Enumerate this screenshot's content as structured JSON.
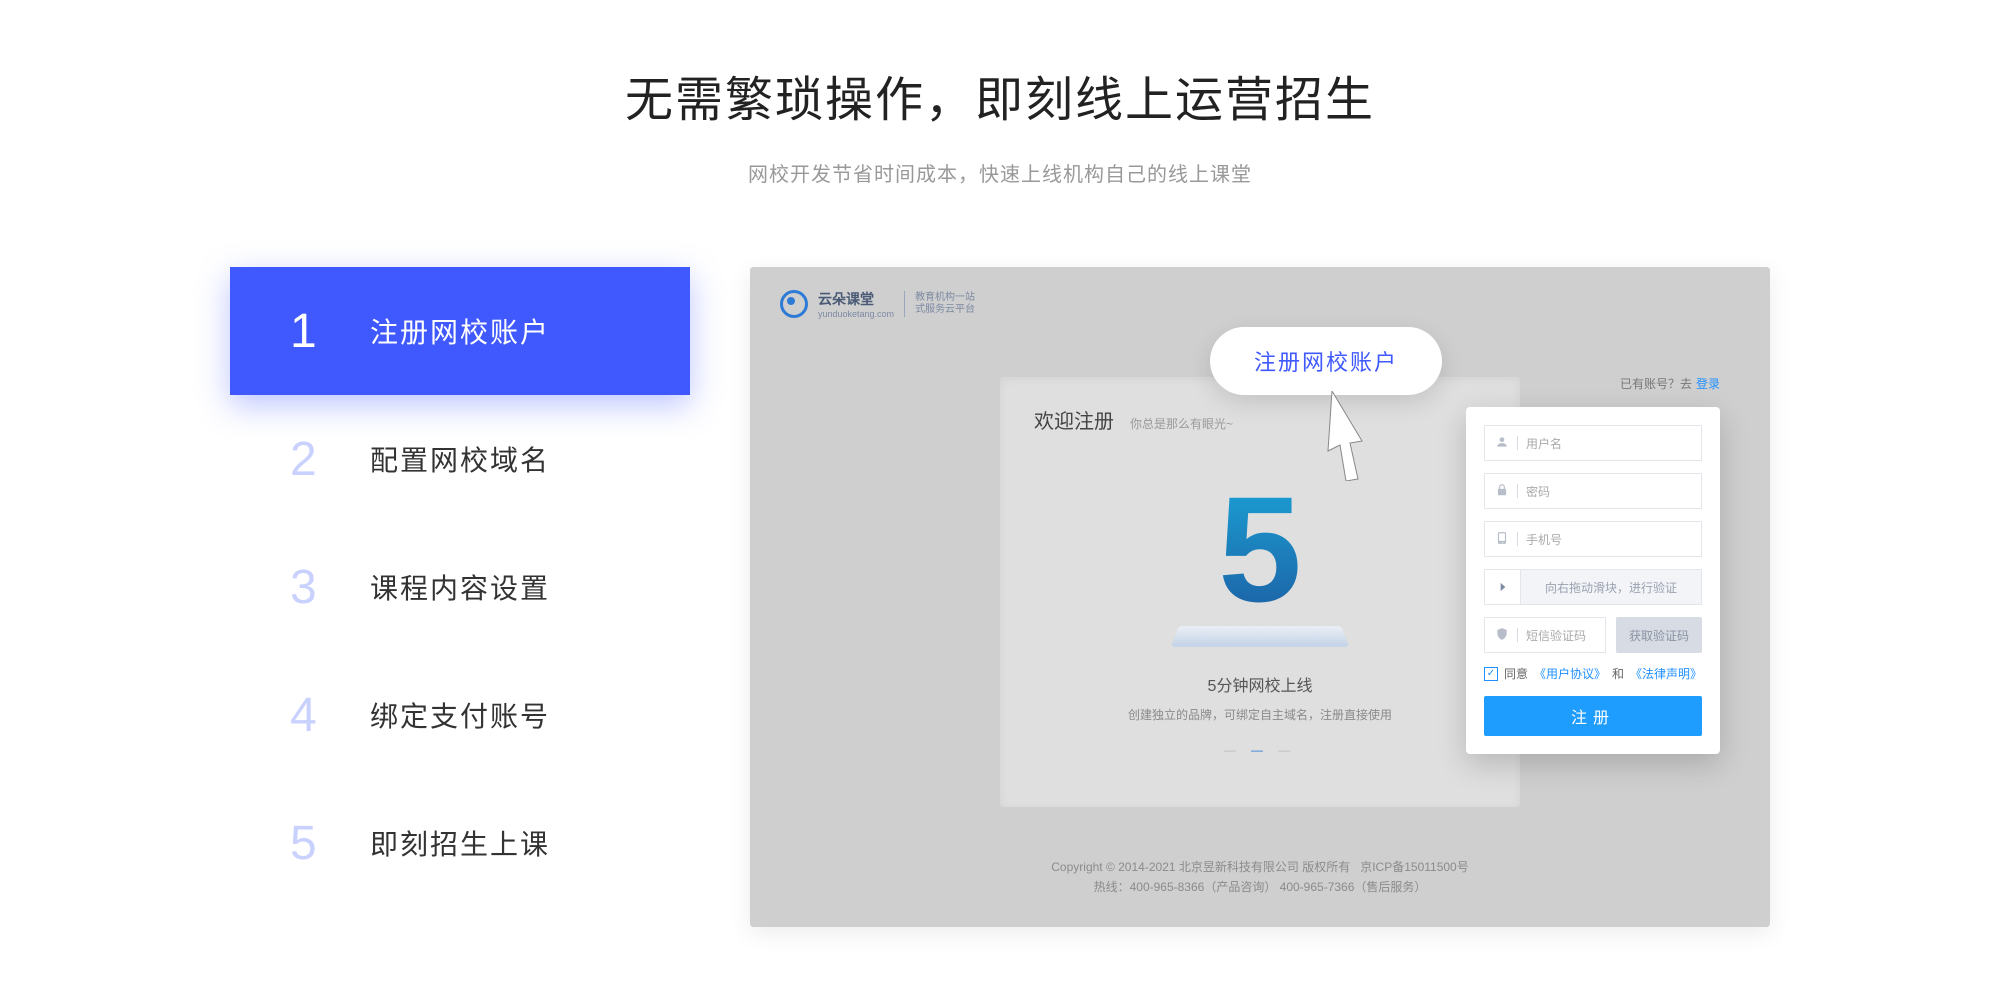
{
  "hero": {
    "title": "无需繁琐操作，即刻线上运营招生",
    "subtitle": "网校开发节省时间成本，快速上线机构自己的线上课堂"
  },
  "steps": [
    {
      "num": "1",
      "label": "注册网校账户",
      "active": true
    },
    {
      "num": "2",
      "label": "配置网校域名",
      "active": false
    },
    {
      "num": "3",
      "label": "课程内容设置",
      "active": false
    },
    {
      "num": "4",
      "label": "绑定支付账号",
      "active": false
    },
    {
      "num": "5",
      "label": "即刻招生上课",
      "active": false
    }
  ],
  "tooltip": {
    "label": "注册网校账户"
  },
  "fakebar": {
    "brand": "云朵课堂",
    "domain": "yunduoketang.com",
    "tag_line1": "教育机构一站",
    "tag_line2": "式服务云平台"
  },
  "gpanel": {
    "title": "欢迎注册",
    "hint": "你总是那么有眼光~",
    "big": "5",
    "caption": "5分钟网校上线",
    "sub": "创建独立的品牌，可绑定自主域名，注册直接使用"
  },
  "card_top": {
    "prefix": "已有账号？去",
    "link": "登录"
  },
  "form": {
    "username_ph": "用户名",
    "password_ph": "密码",
    "phone_ph": "手机号",
    "slider_text": "向右拖动滑块，进行验证",
    "code_ph": "短信验证码",
    "code_btn": "获取验证码",
    "agree_prefix": "同意",
    "tos": "《用户协议》",
    "and": "和",
    "legal": "《法律声明》",
    "submit": "注册"
  },
  "footer": {
    "line1_a": "Copyright © 2014-2021 北京昱新科技有限公司 版权所有",
    "line1_b": "京ICP备15011500号",
    "line2": "热线：400-965-8366（产品咨询） 400-965-7366（售后服务）"
  }
}
